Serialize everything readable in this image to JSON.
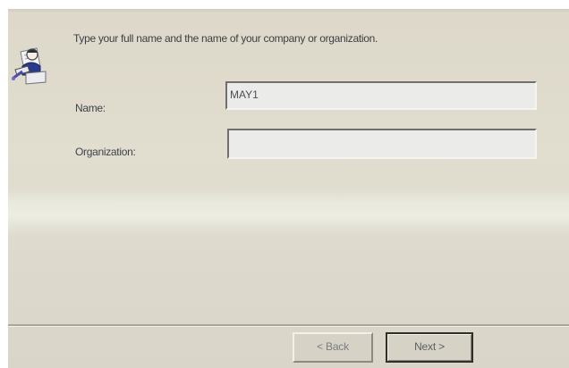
{
  "wizard": {
    "icon": "user-setup-icon",
    "instruction": "Type your full name and the name of your company or organization."
  },
  "form": {
    "name_label": "Name:",
    "name_value": "MAY1",
    "organization_label": "Organization:",
    "organization_value": ""
  },
  "buttons": {
    "back_label": "< Back",
    "next_label": "Next >"
  },
  "colors": {
    "dialog_background": "#ddd8c9",
    "field_background": "#ebebe9",
    "text": "#3b3f45"
  }
}
